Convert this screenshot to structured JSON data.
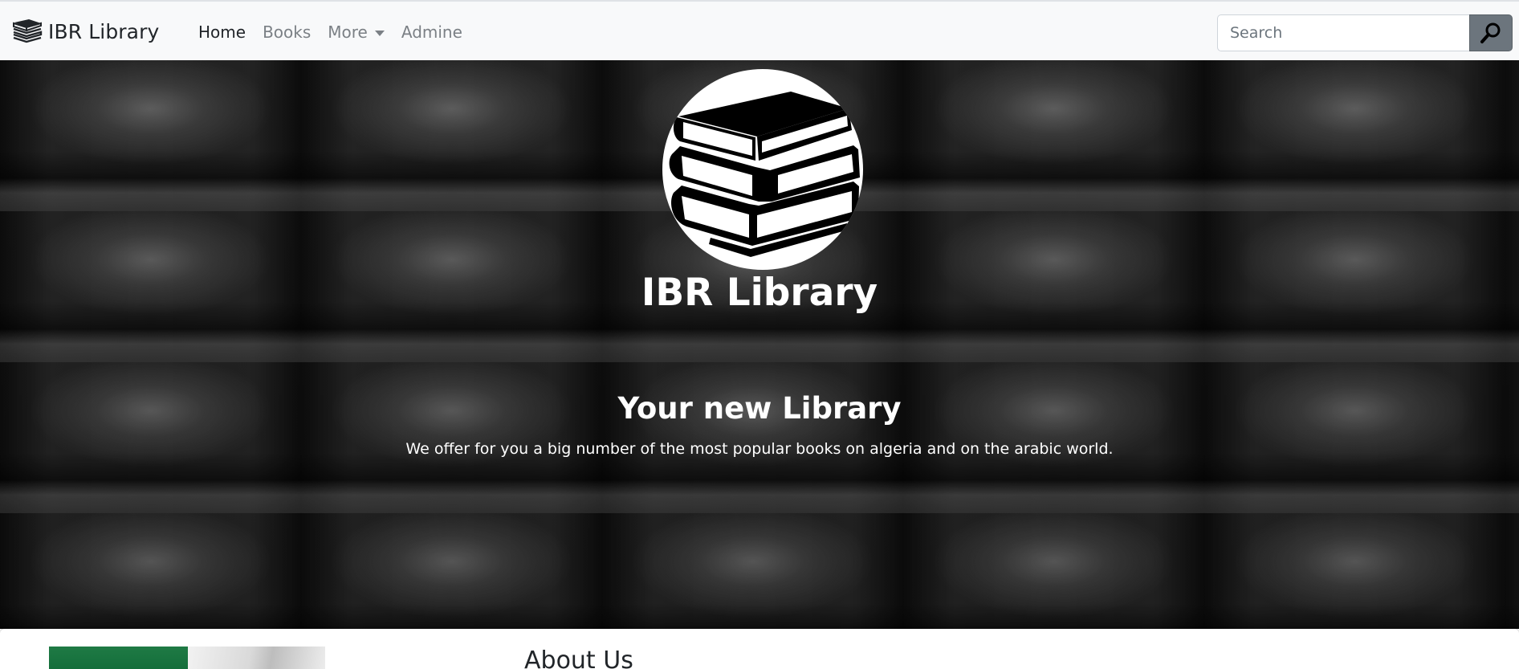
{
  "navbar": {
    "brand_icon": "books-stack-icon",
    "brand_name": "IBR Library",
    "links": [
      {
        "label": "Home",
        "active": true
      },
      {
        "label": "Books",
        "active": false
      },
      {
        "label": "More",
        "active": false,
        "dropdown": true
      },
      {
        "label": "Admine",
        "active": false
      }
    ],
    "search": {
      "placeholder": "Search",
      "value": "",
      "button_icon": "search-icon"
    }
  },
  "hero": {
    "logo_icon": "books-stack-icon",
    "title": "IBR Library",
    "heading": "Your new Library",
    "description": "We offer for you a big number of the most popular books on algeria and on the arabic world."
  },
  "about": {
    "title": "About Us",
    "image": "algeria-flag-image"
  },
  "colors": {
    "navbar_bg": "#f8f9fa",
    "search_button_bg": "#6c757d",
    "hero_text": "#ffffff",
    "active_link": "#212529",
    "inactive_link": "#7b8085"
  }
}
